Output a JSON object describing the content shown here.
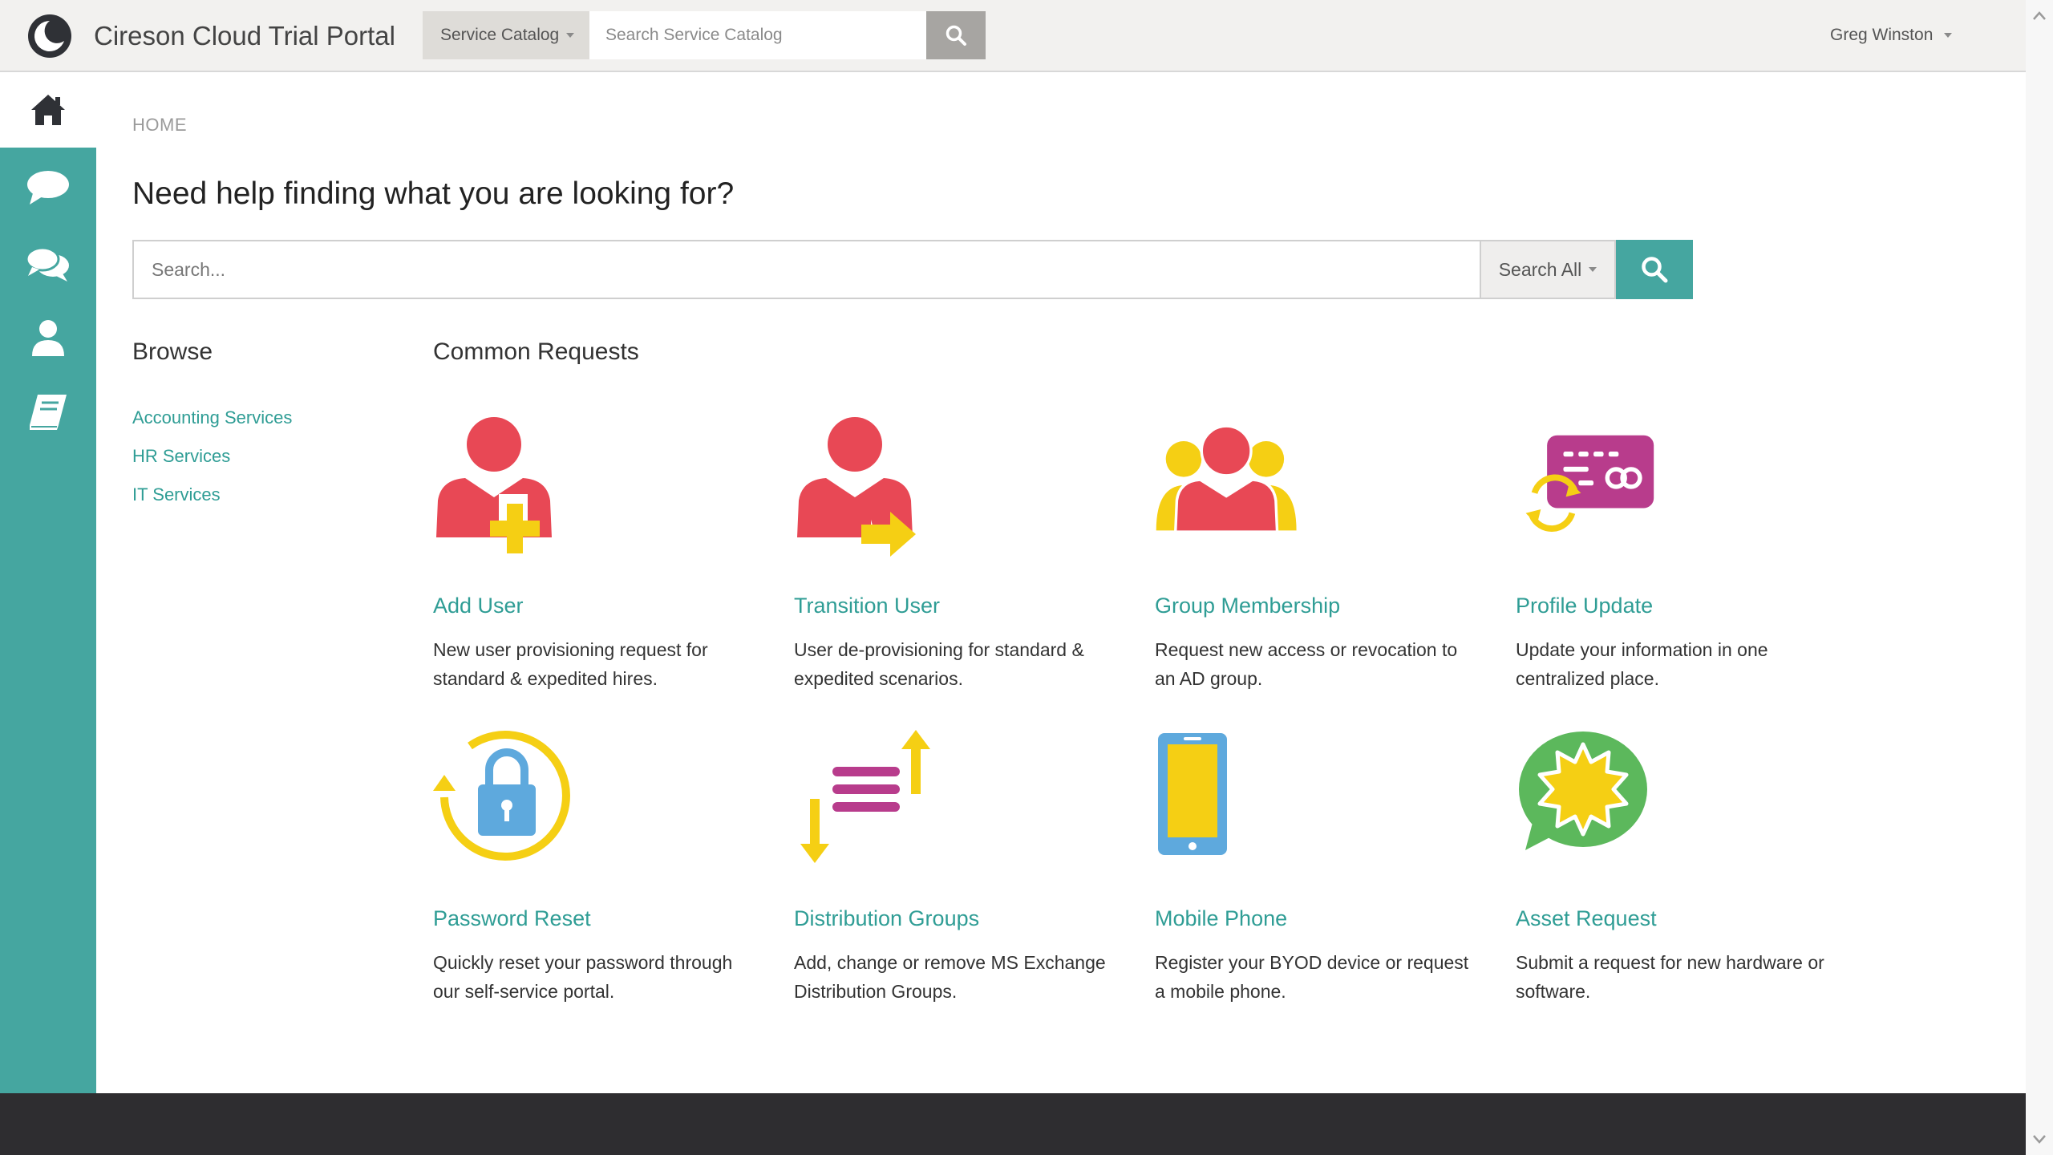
{
  "header": {
    "app_title": "Cireson Cloud Trial Portal",
    "catalog_dropdown": "Service Catalog",
    "catalog_search_placeholder": "Search Service Catalog",
    "user_name": "Greg Winston"
  },
  "breadcrumb": "HOME",
  "main": {
    "heading": "Need help finding what you are looking for?",
    "search_placeholder": "Search...",
    "scope_label": "Search All"
  },
  "browse": {
    "title": "Browse",
    "items": [
      "Accounting Services",
      "HR Services",
      "IT Services"
    ]
  },
  "common": {
    "title": "Common Requests",
    "cards": [
      {
        "title": "Add User",
        "desc": "New user provisioning request for standard & expedited hires.",
        "icon": "add-user-icon"
      },
      {
        "title": "Transition User",
        "desc": "User de-provisioning for standard & expedited scenarios.",
        "icon": "transition-user-icon"
      },
      {
        "title": "Group Membership",
        "desc": "Request new access or revocation to an AD group.",
        "icon": "group-membership-icon"
      },
      {
        "title": "Profile Update",
        "desc": "Update your information in one centralized place.",
        "icon": "profile-update-icon"
      },
      {
        "title": "Password Reset",
        "desc": "Quickly reset your password through our self-service portal.",
        "icon": "password-reset-icon"
      },
      {
        "title": "Distribution Groups",
        "desc": "Add, change or remove MS Exchange Distribution Groups.",
        "icon": "distribution-groups-icon"
      },
      {
        "title": "Mobile Phone",
        "desc": "Register your BYOD device or request a mobile phone.",
        "icon": "mobile-phone-icon"
      },
      {
        "title": "Asset Request",
        "desc": "Submit a request for new hardware or software.",
        "icon": "asset-request-icon"
      }
    ]
  },
  "colors": {
    "accent": "#45a6a0",
    "link": "#2f9d95",
    "red": "#e84855",
    "yellow": "#f5cf14",
    "magenta": "#b83c8c",
    "blue": "#5ea9dd",
    "green": "#5cb85c",
    "footer": "#2e2d30"
  }
}
